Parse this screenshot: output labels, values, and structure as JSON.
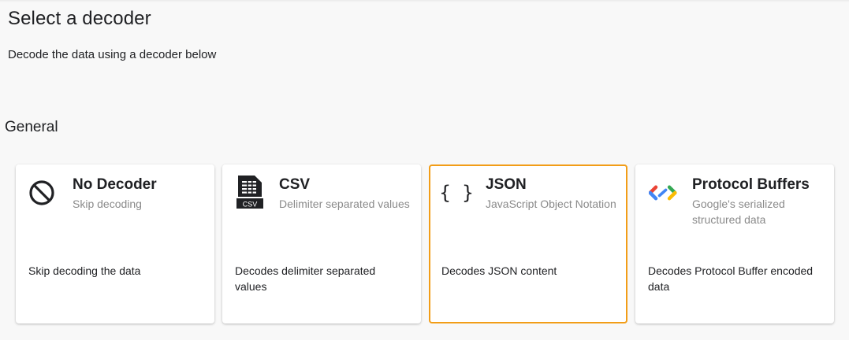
{
  "header": {
    "title": "Select a decoder",
    "subtitle": "Decode the data using a decoder below"
  },
  "section": {
    "heading": "General"
  },
  "cards": [
    {
      "title": "No Decoder",
      "description": "Skip decoding",
      "body": "Skip decoding the data",
      "icon": "block-icon",
      "selected": false
    },
    {
      "title": "CSV",
      "description": "Delimiter separated values",
      "body": "Decodes delimiter separated values",
      "icon": "csv-file-icon",
      "icon_text": "CSV",
      "selected": false
    },
    {
      "title": "JSON",
      "description": "JavaScript Object Notation",
      "body": "Decodes JSON content",
      "icon": "braces-icon",
      "icon_text": "{ }",
      "selected": true
    },
    {
      "title": "Protocol Buffers",
      "description": "Google's serialized structured data",
      "body": "Decodes Protocol Buffer encoded data",
      "icon": "protobuf-logo-icon",
      "selected": false
    }
  ],
  "colors": {
    "background": "#f8f8f8",
    "card_background": "#ffffff",
    "selected_border": "#f29d17",
    "secondary_text": "#8a8a8a",
    "protobuf_blue": "#4285f4",
    "protobuf_red": "#ea4335",
    "protobuf_yellow": "#fbbc04",
    "protobuf_green": "#34a853"
  }
}
